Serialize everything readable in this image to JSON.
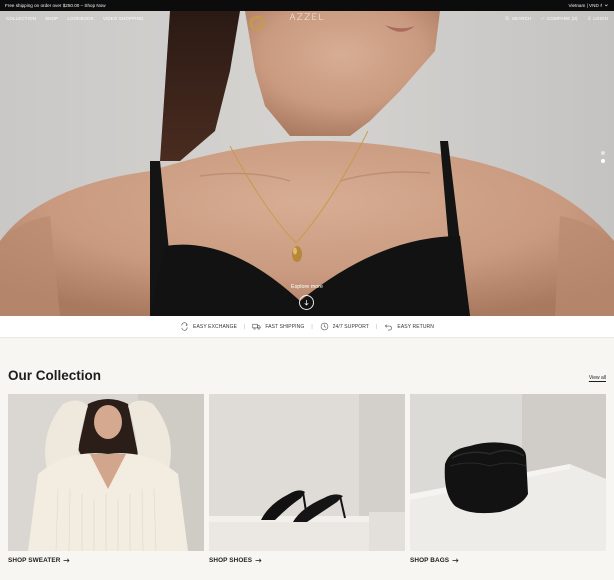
{
  "announcement": {
    "text": "Free shipping on order over $250.00 – Shop Now",
    "locale": "Vietnam | VND ₫"
  },
  "nav": {
    "left": [
      "COLLECTION",
      "SHOP",
      "LOOKBOOK",
      "VIDEO SHOPPING"
    ],
    "logo": "AZZEL",
    "search": "SEARCH",
    "compare": "COMPARE (0)",
    "login": "LOGIN"
  },
  "hero": {
    "explore_label": "Explore more",
    "slides_total": 2,
    "active_slide": 2
  },
  "features": [
    {
      "label": "EASY EXCHANGE",
      "icon": "exchange-icon"
    },
    {
      "label": "FAST SHIPPING",
      "icon": "truck-icon"
    },
    {
      "label": "24/7 SUPPORT",
      "icon": "support-icon"
    },
    {
      "label": "EASY RETURN",
      "icon": "return-icon"
    }
  ],
  "collection": {
    "title": "Our Collection",
    "view_all": "View all",
    "cards": [
      {
        "label": "SHOP SWEATER",
        "image": "woman-in-white-sweater"
      },
      {
        "label": "SHOP SHOES",
        "image": "black-strappy-heels"
      },
      {
        "label": "SHOP BAGS",
        "image": "black-pouch-bag"
      }
    ]
  },
  "colors": {
    "announcement_bg": "#0c0c0c",
    "page_bg": "#f8f6f2",
    "text": "#1d1d1d"
  }
}
